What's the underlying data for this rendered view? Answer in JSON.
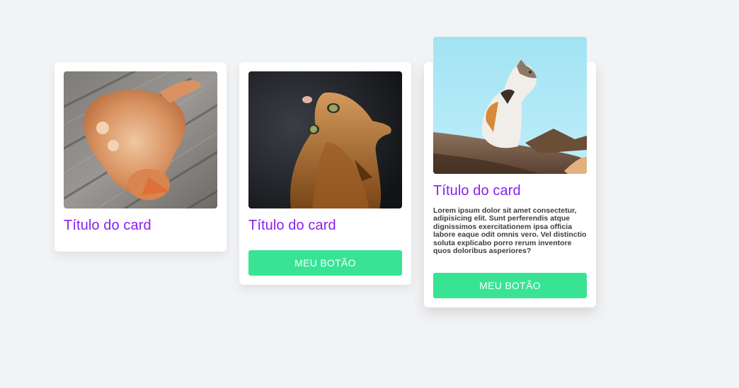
{
  "cards": [
    {
      "title": "Título do card",
      "image": "orange-cat-lying-on-wooden-deck"
    },
    {
      "title": "Título do card",
      "image": "orange-cat-looking-up-dark-background",
      "button_label": "MEU BOTÃO"
    },
    {
      "title": "Título do card",
      "image": "calico-cat-on-branch-blue-sky",
      "text": "Lorem ipsum dolor sit amet consectetur, adipisicing elit. Sunt perferendis atque dignissimos exercitationem ipsa officia labore eaque odit omnis vero. Vel distinctio soluta explicabo porro rerum inventore quos doloribus asperiores?",
      "button_label": "MEU BOTÃO"
    }
  ],
  "colors": {
    "background": "#f2f3f5",
    "title": "#8a1ef0",
    "button": "#38e494"
  }
}
